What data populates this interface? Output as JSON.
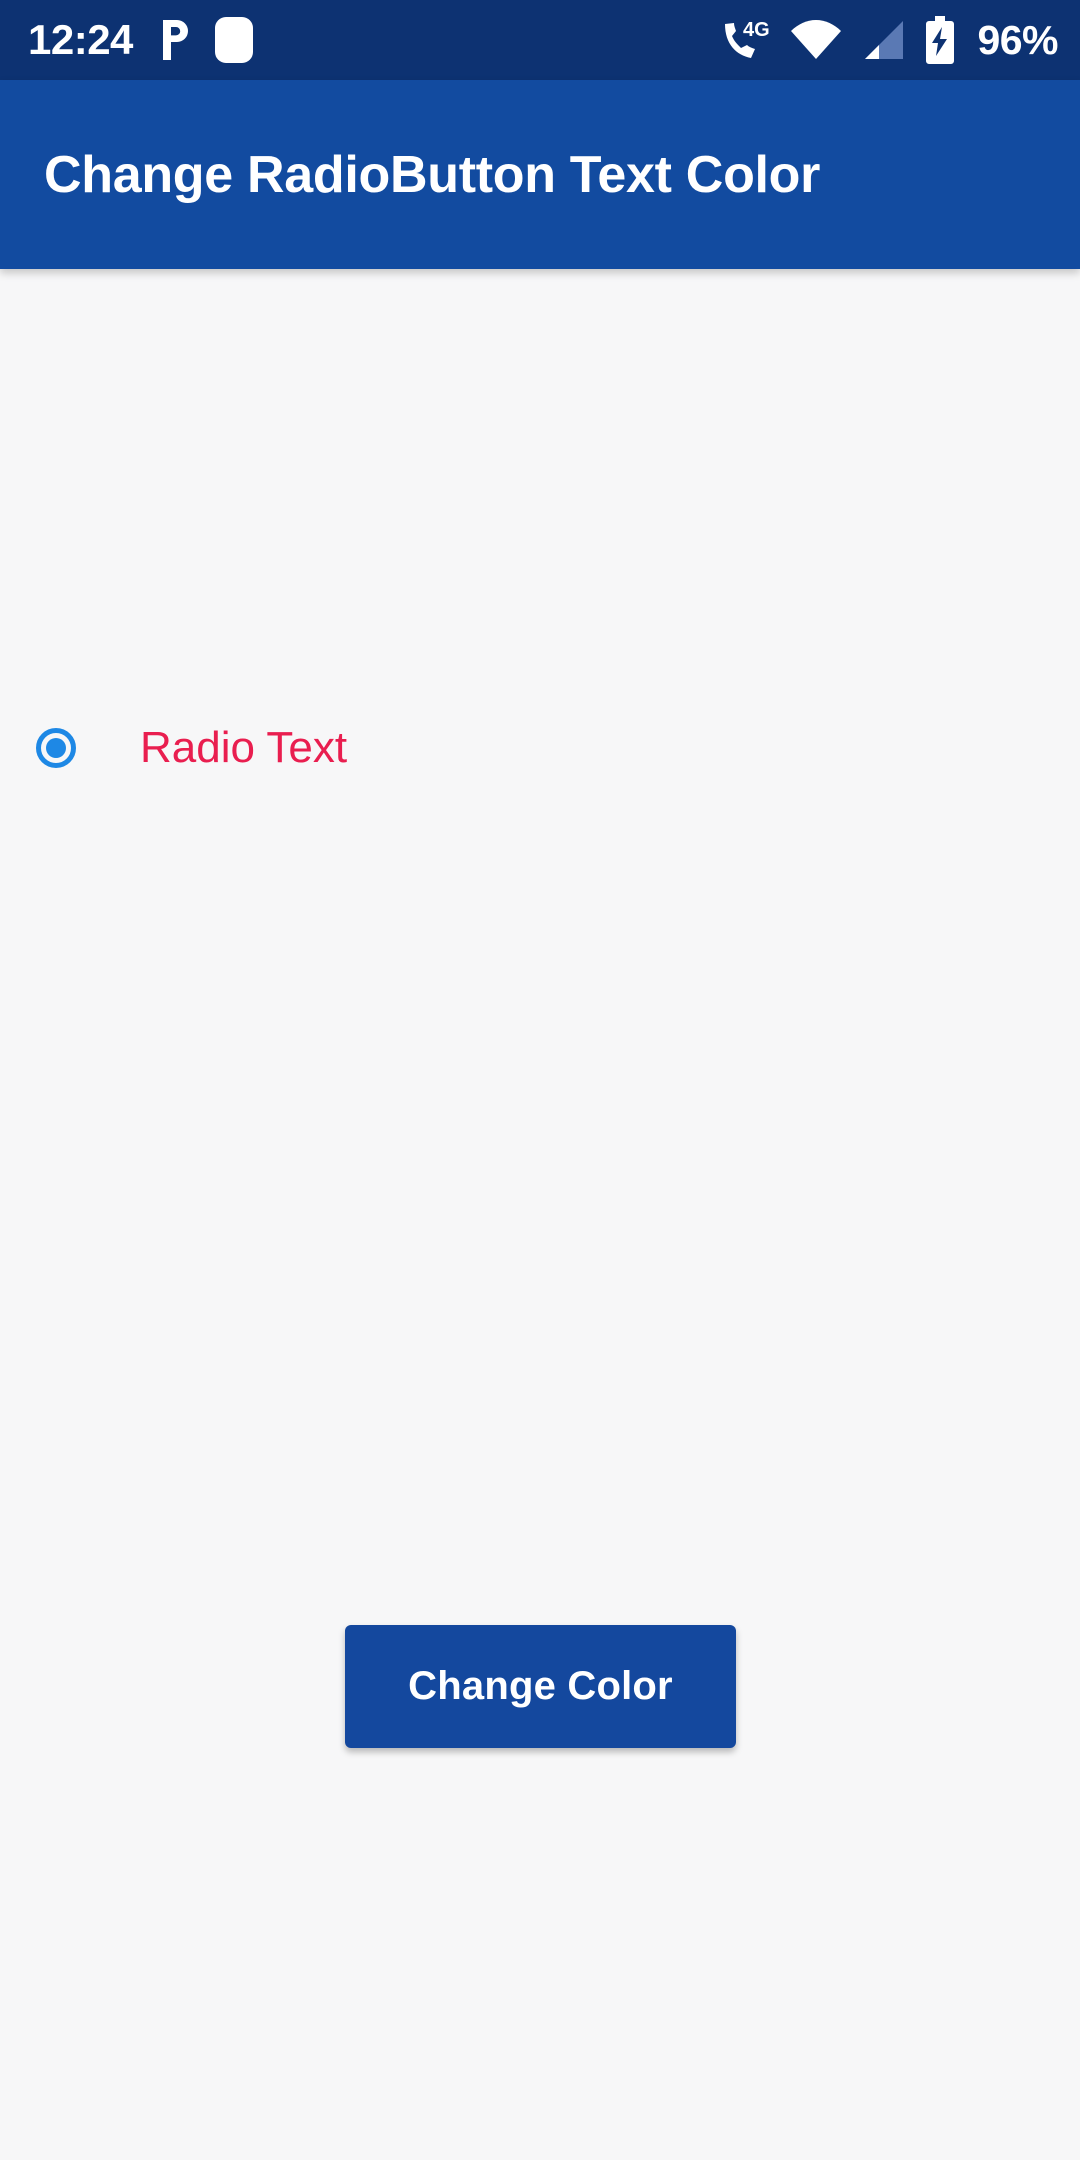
{
  "status_bar": {
    "time": "12:24",
    "battery_percent": "96%",
    "notification_icons": [
      "p-notification-icon",
      "rounded-square-notification-icon"
    ],
    "system_icons": [
      "volte-4g-icon",
      "wifi-icon",
      "cellular-signal-icon",
      "battery-charging-icon"
    ],
    "background_color": "#0d3272",
    "foreground_color": "#ffffff"
  },
  "app_bar": {
    "title": "Change RadioButton Text Color",
    "background_color": "#124ba0",
    "title_color": "#ffffff"
  },
  "content": {
    "background_color": "#f7f7f8",
    "radio_group": {
      "options": [
        {
          "label": "Radio Text",
          "checked": true,
          "control_color": "#1e88e5",
          "label_color": "#e91e4f"
        }
      ]
    },
    "change_color_button": {
      "label": "Change Color",
      "background_color": "#14489e",
      "text_color": "#ffffff"
    }
  }
}
